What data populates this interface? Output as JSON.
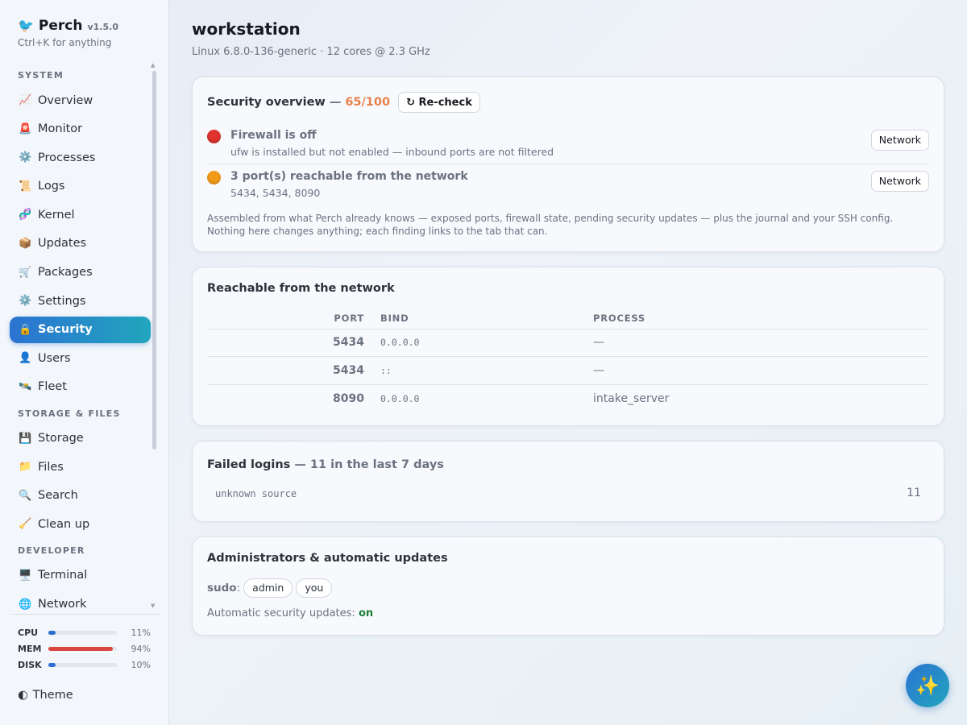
{
  "brand": {
    "icon": "🐦",
    "name": "Perch",
    "version": "v1.5.0",
    "hint": "Ctrl+K for anything"
  },
  "sidebar": {
    "sections": [
      {
        "label": "SYSTEM",
        "items": [
          {
            "icon": "📈",
            "label": "Overview"
          },
          {
            "icon": "🚨",
            "label": "Monitor"
          },
          {
            "icon": "⚙️",
            "label": "Processes"
          },
          {
            "icon": "📜",
            "label": "Logs"
          },
          {
            "icon": "🧬",
            "label": "Kernel"
          },
          {
            "icon": "📦",
            "label": "Updates"
          },
          {
            "icon": "🛒",
            "label": "Packages"
          },
          {
            "icon": "⚙️",
            "label": "Settings"
          },
          {
            "icon": "🔒",
            "label": "Security",
            "active": true
          },
          {
            "icon": "👤",
            "label": "Users"
          },
          {
            "icon": "🛰️",
            "label": "Fleet"
          }
        ]
      },
      {
        "label": "STORAGE & FILES",
        "items": [
          {
            "icon": "💾",
            "label": "Storage"
          },
          {
            "icon": "📁",
            "label": "Files"
          },
          {
            "icon": "🔍",
            "label": "Search"
          },
          {
            "icon": "🧹",
            "label": "Clean up"
          }
        ]
      },
      {
        "label": "DEVELOPER",
        "items": [
          {
            "icon": "🖥️",
            "label": "Terminal"
          },
          {
            "icon": "🌐",
            "label": "Network"
          }
        ]
      }
    ],
    "meters": [
      {
        "label": "CPU",
        "value": "11%",
        "fraction": 0.11,
        "color": "#2c6fd1"
      },
      {
        "label": "MEM",
        "value": "94%",
        "fraction": 0.94,
        "color": "#d9473f"
      },
      {
        "label": "DISK",
        "value": "10%",
        "fraction": 0.1,
        "color": "#2c6fd1"
      }
    ],
    "theme": {
      "icon": "◐",
      "label": "Theme"
    }
  },
  "host": {
    "name": "workstation",
    "subtitle": "Linux 6.8.0-136-generic · 12 cores @ 2.3 GHz"
  },
  "security": {
    "title": "Security overview",
    "dash": "—",
    "score": "65/100",
    "score_color": "#e8804b",
    "recheck_label": "↻ Re-check",
    "findings": [
      {
        "severity": "red",
        "title": "Firewall is off",
        "desc": "ufw is installed but not enabled — inbound ports are not filtered",
        "link": "Network"
      },
      {
        "severity": "orange",
        "title": "3 port(s) reachable from the network",
        "desc": "5434, 5434, 8090",
        "link": "Network"
      }
    ],
    "note": "Assembled from what Perch already knows — exposed ports, firewall state, pending security updates — plus the journal and your SSH config. Nothing here changes anything; each finding links to the tab that can."
  },
  "reachable": {
    "title": "Reachable from the network",
    "columns": [
      "PORT",
      "BIND",
      "PROCESS"
    ],
    "rows": [
      {
        "port": "5434",
        "bind": "0.0.0.0",
        "process": "—"
      },
      {
        "port": "5434",
        "bind": "::",
        "process": "—"
      },
      {
        "port": "8090",
        "bind": "0.0.0.0",
        "process": "intake_server"
      }
    ]
  },
  "logins": {
    "title": "Failed logins",
    "summary": "— 11 in the last 7 days",
    "rows": [
      {
        "source": "unknown source",
        "count": "11"
      }
    ]
  },
  "admins": {
    "title": "Administrators & automatic updates",
    "sudo_label": "sudo",
    "sudo_users": [
      "admin",
      "you"
    ],
    "auto_label": "Automatic security updates:",
    "auto_value": "on",
    "auto_color": "#1a7f37"
  },
  "fab": {
    "icon": "✨"
  }
}
